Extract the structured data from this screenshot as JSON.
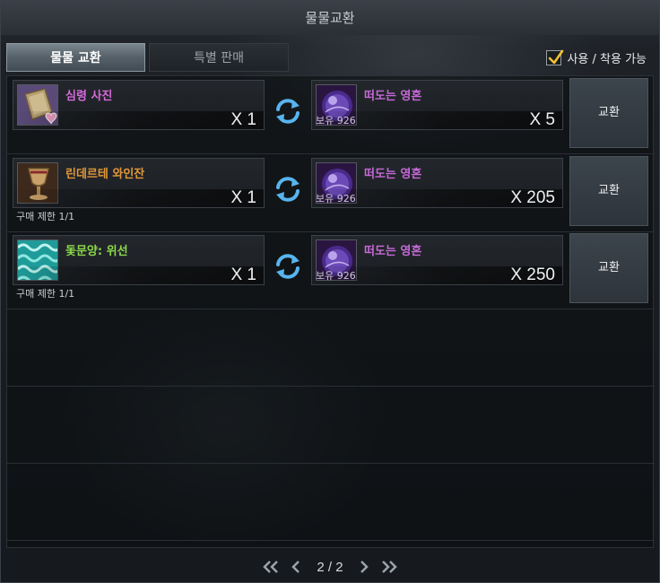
{
  "window": {
    "title": "물물교환"
  },
  "tabs": [
    {
      "label": "물물 교환",
      "active": true
    },
    {
      "label": "특별 판매",
      "active": false
    }
  ],
  "filter": {
    "label": "사용 / 착용 가능",
    "checked": true
  },
  "rows": [
    {
      "give": {
        "name": "심령 사진",
        "name_color": "#d56adb",
        "qty": "X 1",
        "limit": "",
        "icon": "album-heart-icon"
      },
      "get": {
        "name": "떠도는 영혼",
        "name_color": "#c66ad8",
        "owned": "보유 926",
        "qty": "X 5",
        "icon": "purple-orb-icon"
      },
      "button": "교환"
    },
    {
      "give": {
        "name": "린데르테 와인잔",
        "name_color": "#e0973a",
        "qty": "X 1",
        "limit": "구매 제한 1/1",
        "icon": "wine-glass-icon"
      },
      "get": {
        "name": "떠도는 영혼",
        "name_color": "#c66ad8",
        "owned": "보유 926",
        "qty": "X 205",
        "icon": "purple-orb-icon"
      },
      "button": "교환"
    },
    {
      "give": {
        "name": "돛문양: 위선",
        "name_color": "#8bd94a",
        "qty": "X 1",
        "limit": "구매 제한 1/1",
        "icon": "sail-pattern-icon"
      },
      "get": {
        "name": "떠도는 영혼",
        "name_color": "#c66ad8",
        "owned": "보유 926",
        "qty": "X 250",
        "icon": "purple-orb-icon"
      },
      "button": "교환"
    }
  ],
  "pager": {
    "text": "2 / 2"
  }
}
